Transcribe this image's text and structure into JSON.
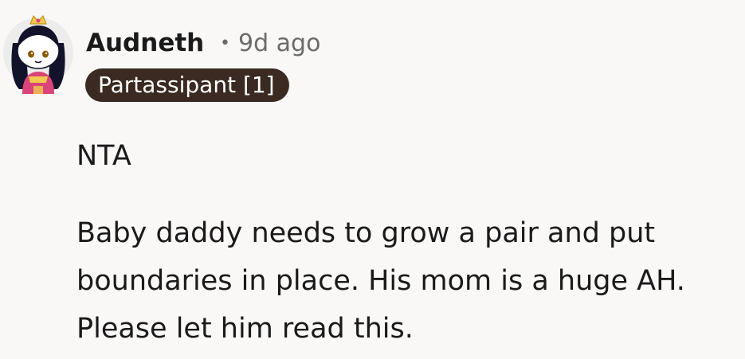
{
  "comment": {
    "author": "Audneth",
    "separator": "•",
    "timestamp": "9d ago",
    "flair": "Partassipant [1]",
    "body": [
      "NTA",
      "Baby daddy needs to grow a pair and put boundaries in place. His mom is a huge AH. Please let him read this."
    ]
  },
  "colors": {
    "background": "#f9f8f7",
    "flair_bg": "#3b2a21",
    "flair_text": "#ffffff",
    "meta_text": "#6b6b6b",
    "body_text": "#1a1a1b"
  },
  "icons": {
    "avatar": "snoo-avatar-icon"
  }
}
